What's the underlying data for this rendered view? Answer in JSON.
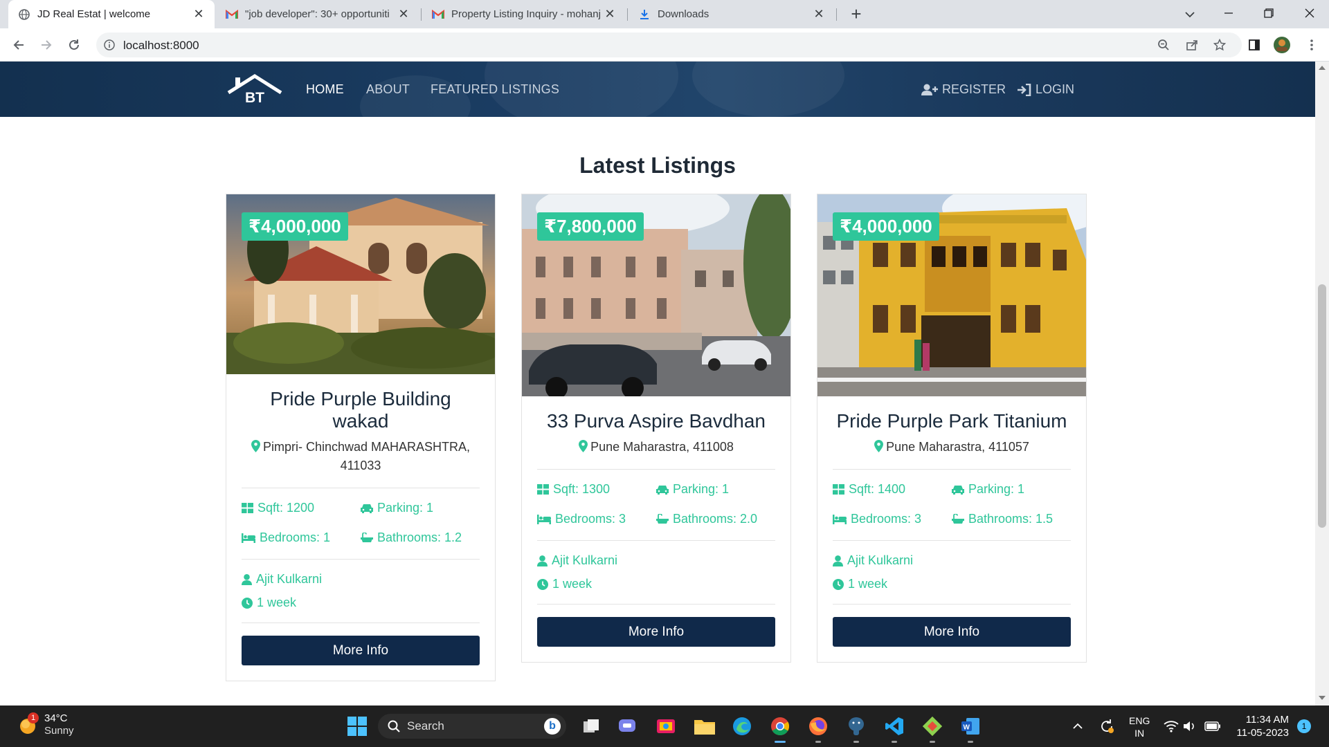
{
  "browser": {
    "tabs": [
      {
        "title": "JD Real Estat | welcome",
        "active": true,
        "icon": "globe-icon"
      },
      {
        "title": "\"job developer\": 30+ opportuniti",
        "active": false,
        "icon": "gmail-icon"
      },
      {
        "title": "Property Listing Inquiry - mohanj",
        "active": false,
        "icon": "gmail-icon"
      },
      {
        "title": "Downloads",
        "active": false,
        "icon": "download-icon"
      }
    ],
    "url": "localhost:8000"
  },
  "navbar": {
    "logo_text": "BT",
    "links": [
      "HOME",
      "ABOUT",
      "FEATURED LISTINGS"
    ],
    "register": "REGISTER",
    "login": "LOGIN"
  },
  "section": {
    "heading": "Latest Listings"
  },
  "listings": [
    {
      "price": "₹4,000,000",
      "title": "Pride Purple Building wakad",
      "address": "Pimpri- Chinchwad MAHARASHTRA, 411033",
      "sqft": "Sqft: 1200",
      "parking": "Parking: 1",
      "bedrooms": "Bedrooms: 1",
      "bathrooms": "Bathrooms: 1.2",
      "realtor": "Ajit Kulkarni",
      "listed": "1 week",
      "button": "More Info"
    },
    {
      "price": "₹7,800,000",
      "title": "33 Purva Aspire Bavdhan",
      "address": "Pune Maharastra, 411008",
      "sqft": "Sqft: 1300",
      "parking": "Parking: 1",
      "bedrooms": "Bedrooms: 3",
      "bathrooms": "Bathrooms: 2.0",
      "realtor": "Ajit Kulkarni",
      "listed": "1 week",
      "button": "More Info"
    },
    {
      "price": "₹4,000,000",
      "title": "Pride Purple Park Titanium",
      "address": "Pune Maharastra, 411057",
      "sqft": "Sqft: 1400",
      "parking": "Parking: 1",
      "bedrooms": "Bedrooms: 3",
      "bathrooms": "Bathrooms: 1.5",
      "realtor": "Ajit Kulkarni",
      "listed": "1 week",
      "button": "More Info"
    }
  ],
  "taskbar": {
    "weather": {
      "temp": "34°C",
      "condition": "Sunny",
      "badge": "1"
    },
    "search_label": "Search",
    "language": {
      "line1": "ENG",
      "line2": "IN"
    },
    "clock": {
      "time": "11:34 AM",
      "date": "11-05-2023"
    },
    "notification_count": "1"
  },
  "colors": {
    "accent": "#2fc69a",
    "navy": "#10294a"
  }
}
